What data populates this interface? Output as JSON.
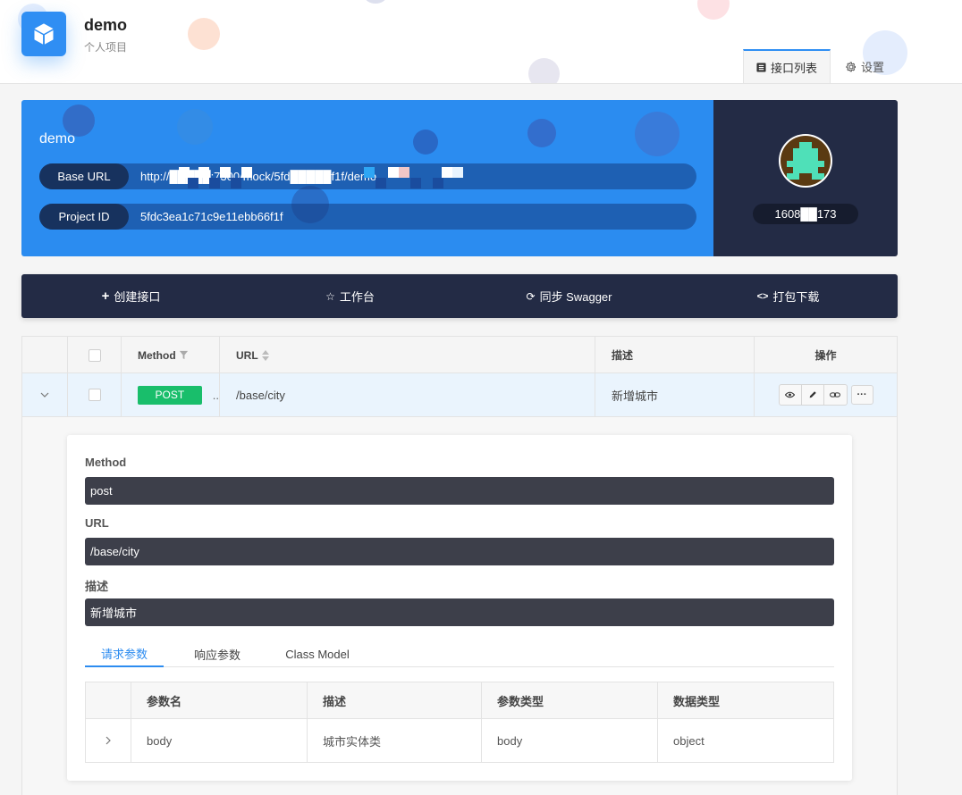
{
  "header": {
    "project_name": "demo",
    "project_type": "个人项目",
    "tabs": [
      {
        "label": "接口列表",
        "icon": "list-icon",
        "active": true
      },
      {
        "label": "设置",
        "icon": "gear-icon",
        "active": false
      }
    ]
  },
  "banner": {
    "title": "demo",
    "base_url_label": "Base URL",
    "base_url_value": "http://█████:7300/mock/5fd█████f1f/demo",
    "project_id_label": "Project ID",
    "project_id_value": "5fdc3ea1c71c9e11ebb66f1f"
  },
  "user": {
    "id_display": "1608██173"
  },
  "actions": [
    {
      "label": "创建接口",
      "icon": "plus-icon"
    },
    {
      "label": "工作台",
      "icon": "star-icon"
    },
    {
      "label": "同步 Swagger",
      "icon": "sync-icon"
    },
    {
      "label": "打包下载",
      "icon": "code-icon"
    }
  ],
  "table": {
    "headers": {
      "method": "Method",
      "url": "URL",
      "description": "描述",
      "operation": "操作"
    },
    "rows": [
      {
        "method": "POST",
        "url": "/base/city",
        "description": "新增城市",
        "truncation": ".."
      }
    ]
  },
  "detail": {
    "method_label": "Method",
    "method_value": "post",
    "url_label": "URL",
    "url_value": "/base/city",
    "desc_label": "描述",
    "desc_value": "新增城市",
    "tabs": [
      "请求参数",
      "响应参数",
      "Class Model"
    ],
    "active_tab": "请求参数",
    "params_headers": [
      "参数名",
      "描述",
      "参数类型",
      "数据类型"
    ],
    "params_rows": [
      {
        "name": "body",
        "description": "城市实体类",
        "param_type": "body",
        "data_type": "object"
      }
    ]
  },
  "colors": {
    "accent": "#2b8cf0",
    "dark_navy": "#232b45",
    "post_green": "#19be6b",
    "detail_box": "#3d3f4a"
  }
}
